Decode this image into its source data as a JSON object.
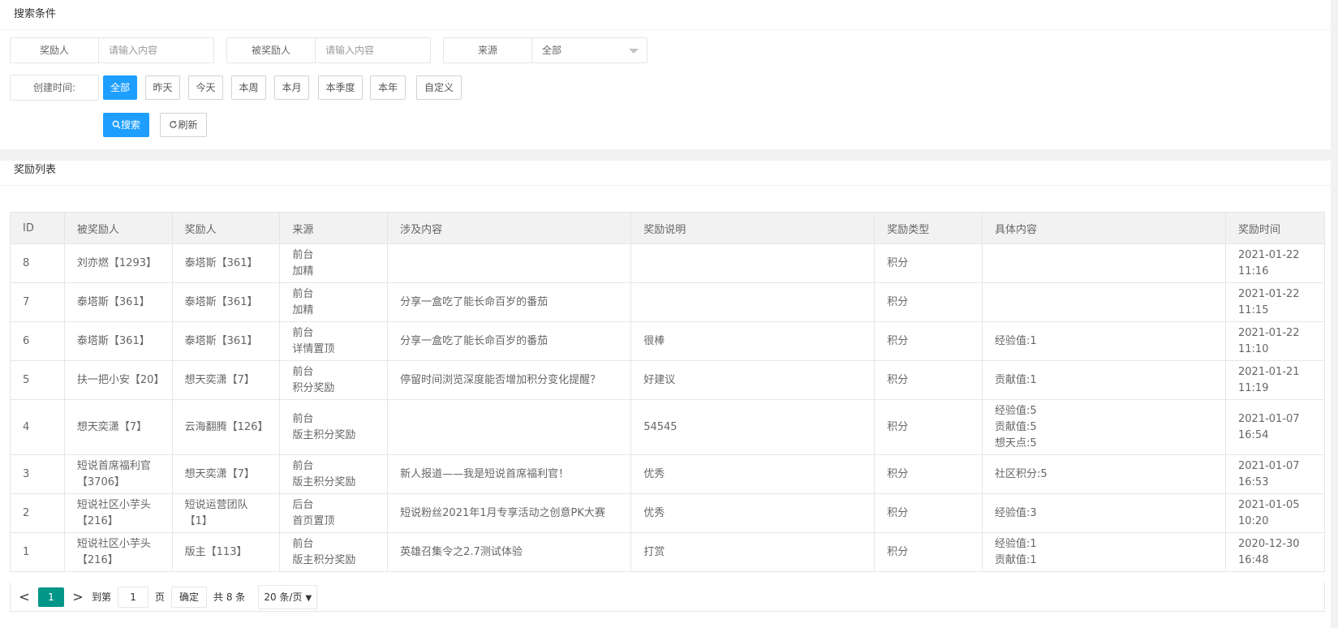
{
  "search": {
    "title": "搜索条件",
    "rewarder_label": "奖励人",
    "rewarder_placeholder": "请输入内容",
    "rewardee_label": "被奖励人",
    "rewardee_placeholder": "请输入内容",
    "source_label": "来源",
    "source_value": "全部",
    "time_label": "创建时间:",
    "time_options": [
      "全部",
      "昨天",
      "今天",
      "本周",
      "本月",
      "本季度",
      "本年",
      "自定义"
    ],
    "search_button": "搜索",
    "refresh_button": "刷新"
  },
  "list": {
    "title": "奖励列表",
    "columns": [
      "ID",
      "被奖励人",
      "奖励人",
      "来源",
      "涉及内容",
      "奖励说明",
      "奖励类型",
      "具体内容",
      "奖励时间"
    ],
    "rows": [
      {
        "id": "8",
        "rewardee": "刘亦燃【1293】",
        "rewarder": "泰塔斯【361】",
        "source1": "前台",
        "source2": "加精",
        "content": "",
        "note": "",
        "type": "积分",
        "detail1": "",
        "detail2": "",
        "detail3": "",
        "time": "2021-01-22 11:16"
      },
      {
        "id": "7",
        "rewardee": "泰塔斯【361】",
        "rewarder": "泰塔斯【361】",
        "source1": "前台",
        "source2": "加精",
        "content": "分享一盒吃了能长命百岁的番茄",
        "note": "",
        "type": "积分",
        "detail1": "",
        "detail2": "",
        "detail3": "",
        "time": "2021-01-22 11:15"
      },
      {
        "id": "6",
        "rewardee": "泰塔斯【361】",
        "rewarder": "泰塔斯【361】",
        "source1": "前台",
        "source2": "详情置顶",
        "content": "分享一盒吃了能长命百岁的番茄",
        "note": "很棒",
        "type": "积分",
        "detail1": "经验值:1",
        "detail2": "",
        "detail3": "",
        "time": "2021-01-22 11:10"
      },
      {
        "id": "5",
        "rewardee": "扶一把小安【20】",
        "rewarder": "想天奕潇【7】",
        "source1": "前台",
        "source2": "积分奖励",
        "content": "停留时间浏览深度能否增加积分变化提醒？",
        "note": "好建议",
        "type": "积分",
        "detail1": "贡献值:1",
        "detail2": "",
        "detail3": "",
        "time": "2021-01-21 11:19"
      },
      {
        "id": "4",
        "rewardee": "想天奕潇【7】",
        "rewarder": "云海翻腾【126】",
        "source1": "前台",
        "source2": "版主积分奖励",
        "content": "",
        "note": "54545",
        "type": "积分",
        "detail1": "经验值:5",
        "detail2": "贡献值:5",
        "detail3": "想天点:5",
        "time": "2021-01-07 16:54"
      },
      {
        "id": "3",
        "rewardee": "短说首席福利官【3706】",
        "rewarder": "想天奕潇【7】",
        "source1": "前台",
        "source2": "版主积分奖励",
        "content": "新人报道——我是短说首席福利官！",
        "note": "优秀",
        "type": "积分",
        "detail1": "社区积分:5",
        "detail2": "",
        "detail3": "",
        "time": "2021-01-07 16:53"
      },
      {
        "id": "2",
        "rewardee": "短说社区小芋头【216】",
        "rewarder": "短说运营团队【1】",
        "source1": "后台",
        "source2": "首页置顶",
        "content": "短说粉丝2021年1月专享活动之创意PK大赛",
        "note": "优秀",
        "type": "积分",
        "detail1": "经验值:3",
        "detail2": "",
        "detail3": "",
        "time": "2021-01-05 10:20"
      },
      {
        "id": "1",
        "rewardee": "短说社区小芋头【216】",
        "rewarder": "版主【113】",
        "source1": "前台",
        "source2": "版主积分奖励",
        "content": "英雄召集令之2.7测试体验",
        "note": "打赏",
        "type": "积分",
        "detail1": "经验值:1",
        "detail2": "贡献值:1",
        "detail3": "",
        "time": "2020-12-30 16:48"
      }
    ]
  },
  "pager": {
    "prev": "<",
    "current": "1",
    "next": ">",
    "goto_label": "到第",
    "goto_value": "1",
    "page_unit": "页",
    "confirm": "确定",
    "total": "共 8 条",
    "page_size": "20 条/页"
  }
}
